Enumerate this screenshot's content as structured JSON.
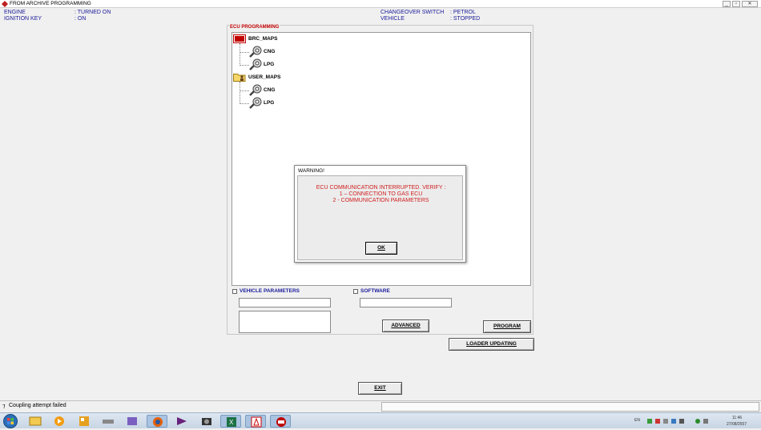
{
  "window": {
    "title": "FROM ARCHIVE PROGRAMMING",
    "min": "_",
    "max": "▫",
    "close": "✕"
  },
  "info": {
    "engine_label": "ENGINE",
    "engine_value": ": TURNED ON",
    "ignition_label": "IGNITION KEY",
    "ignition_value": ": ON",
    "changeover_label": "CHANGEOVER SWITCH",
    "changeover_value": ": PETROL",
    "vehicle_label": "VEHICLE",
    "vehicle_value": ": STOPPED"
  },
  "panel": {
    "label": "ECU PROGRAMMING"
  },
  "tree": {
    "brc": {
      "label": "BRC_MAPS",
      "children": [
        "CNG",
        "LPG"
      ]
    },
    "user": {
      "label": "USER_MAPS",
      "children": [
        "CNG",
        "LPG"
      ]
    }
  },
  "options": {
    "vehicle_parameters": "VEHICLE PARAMETERS",
    "software": "SOFTWARE"
  },
  "buttons": {
    "advanced": "ADVANCED",
    "program": "PROGRAM",
    "loader_updating": "LOADER UPDATING",
    "exit": "EXIT"
  },
  "dialog": {
    "title": "WARNING!",
    "line1": "ECU COMMUNICATION INTERRUPTED. VERIFY :",
    "line2": "1 – CONNECTION TO GAS ECU",
    "line3": "2 - COMMUNICATION PARAMETERS",
    "ok": "OK"
  },
  "status": {
    "message": "Coupling attempt failed"
  },
  "taskbar": {
    "lang": "EN",
    "time": "11:46",
    "date": "27/08/2557"
  },
  "colors": {
    "accent": "#1a1a8c",
    "warning": "#d02020",
    "brc_red": "#c00000"
  }
}
